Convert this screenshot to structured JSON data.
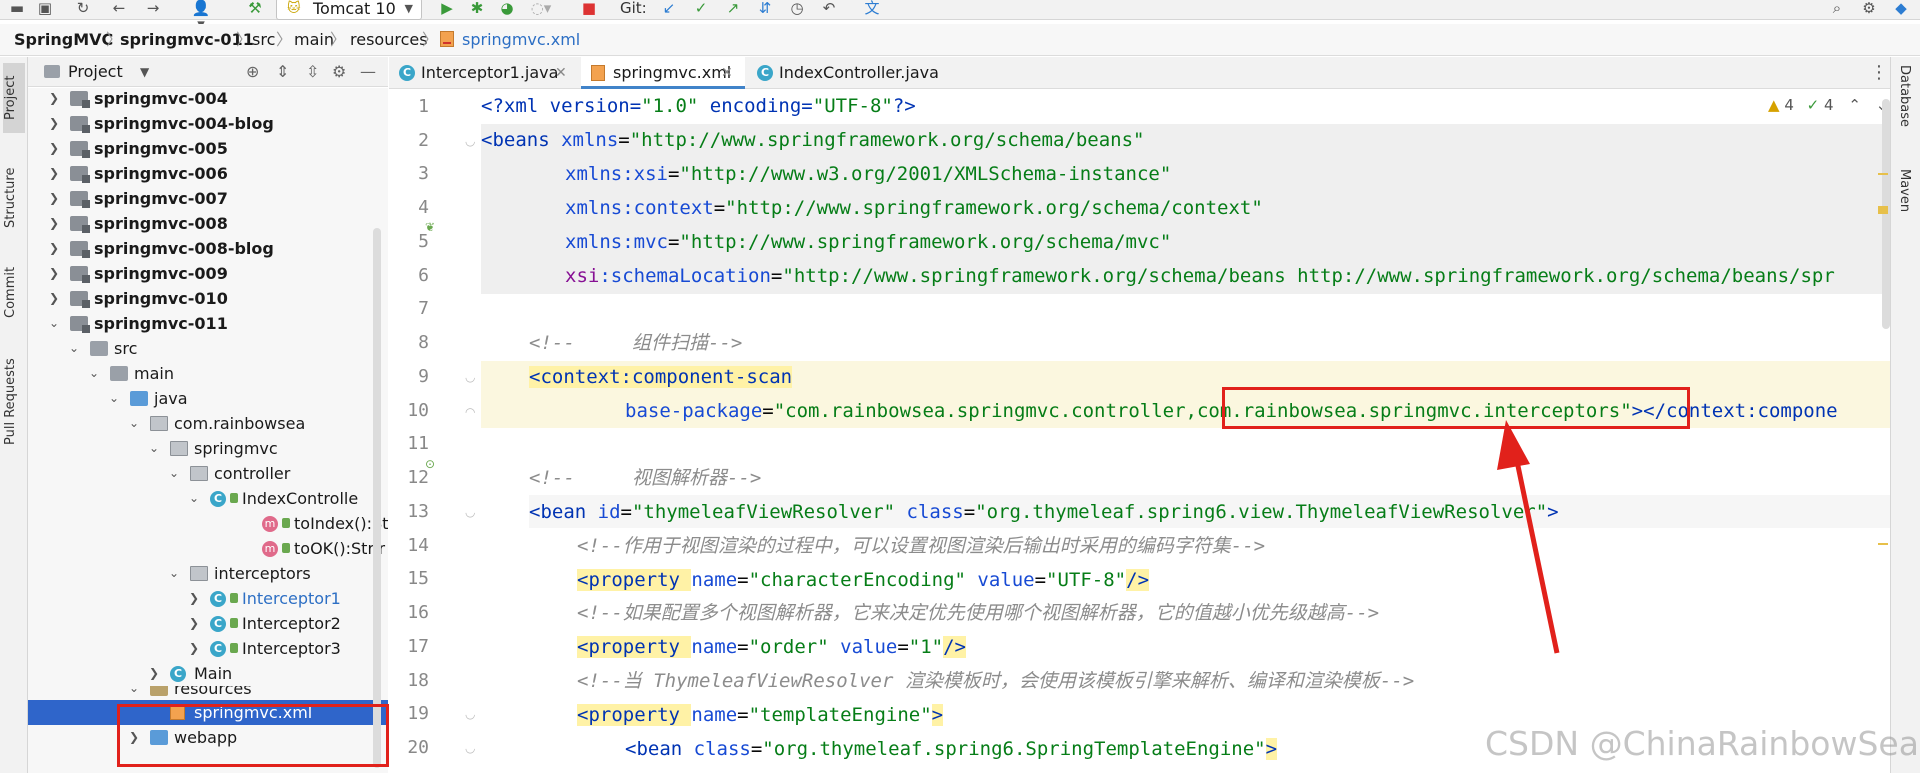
{
  "toolbar": {
    "run_config": "Tomcat 10",
    "git_label": "Git:"
  },
  "breadcrumb": [
    "SpringMVC",
    "springmvc-011",
    "src",
    "main",
    "resources",
    "springmvc.xml"
  ],
  "left_tabs": [
    "Project",
    "Structure",
    "Commit",
    "Pull Requests"
  ],
  "right_tabs": [
    "Database",
    "Maven"
  ],
  "project": {
    "title": "Project",
    "tree": [
      {
        "label": "springmvc-004",
        "bold": true
      },
      {
        "label": "springmvc-004-blog",
        "bold": true
      },
      {
        "label": "springmvc-005",
        "bold": true
      },
      {
        "label": "springmvc-006",
        "bold": true
      },
      {
        "label": "springmvc-007",
        "bold": true
      },
      {
        "label": "springmvc-008",
        "bold": true
      },
      {
        "label": "springmvc-008-blog",
        "bold": true
      },
      {
        "label": "springmvc-009",
        "bold": true
      },
      {
        "label": "springmvc-010",
        "bold": true
      },
      {
        "label": "springmvc-011",
        "bold": true
      },
      {
        "label": "src"
      },
      {
        "label": "main"
      },
      {
        "label": "java"
      },
      {
        "label": "com.rainbowsea"
      },
      {
        "label": "springmvc"
      },
      {
        "label": "controller"
      },
      {
        "label": "IndexControlle"
      },
      {
        "label": "toIndex():St"
      },
      {
        "label": "toOK():Strir"
      },
      {
        "label": "interceptors"
      },
      {
        "label": "Interceptor1"
      },
      {
        "label": "Interceptor2"
      },
      {
        "label": "Interceptor3"
      },
      {
        "label": "Main"
      },
      {
        "label": "resources"
      },
      {
        "label": "springmvc.xml"
      },
      {
        "label": "webapp"
      }
    ]
  },
  "tabs": [
    {
      "label": "Interceptor1.java"
    },
    {
      "label": "springmvc.xml"
    },
    {
      "label": "IndexController.java"
    }
  ],
  "inspections": {
    "warnings": "4",
    "weak": "4"
  },
  "code": {
    "l1": {
      "a": "<?xml version=",
      "b": "\"1.0\"",
      "c": " encoding=",
      "d": "\"UTF-8\"",
      "e": "?>"
    },
    "l2": {
      "a": "<beans ",
      "b": "xmlns",
      "c": "=",
      "d": "\"http://www.springframework.org/schema/beans\""
    },
    "l3": {
      "a": "xmlns",
      "b": ":xsi",
      "c": "=",
      "d": "\"http://www.w3.org/2001/XMLSchema-instance\""
    },
    "l4": {
      "a": "xmlns",
      "b": ":context",
      "c": "=",
      "d": "\"http://www.springframework.org/schema/context\""
    },
    "l5": {
      "a": "xmlns",
      "b": ":mvc",
      "c": "=",
      "d": "\"http://www.springframework.org/schema/mvc\""
    },
    "l6": {
      "a": "xsi",
      "b": ":schemaLocation",
      "c": "=",
      "d": "\"http://www.springframework.org/schema/beans http://www.springframework.org/schema/beans/spr"
    },
    "l8": "<!--     组件扫描-->",
    "l9": {
      "a": "<",
      "b": "context",
      "c": ":component-scan"
    },
    "l10": {
      "a": "base-package",
      "b": "=",
      "c": "\"com.rainbowsea.springmvc.controller,",
      "d": "com.rainbowsea.springmvc.interceptors\"",
      "e": ">",
      "f": "</",
      "g": "context",
      "h": ":compone"
    },
    "l12": "<!--     视图解析器-->",
    "l13": {
      "a": "<bean ",
      "b": "id",
      "c": "=",
      "d": "\"thymeleafViewResolver\"",
      "e": " class",
      "f": "=",
      "g": "\"org.thymeleaf.spring6.view.ThymeleafViewResolver\"",
      "h": ">"
    },
    "l14": "<!--作用于视图渲染的过程中，可以设置视图渲染后输出时采用的编码字符集-->",
    "l15": {
      "a": "<property ",
      "b": "name",
      "c": "=",
      "d": "\"characterEncoding\"",
      "e": " value",
      "f": "=",
      "g": "\"UTF-8\"",
      "h": "/>"
    },
    "l16": "<!--如果配置多个视图解析器，它来决定优先使用哪个视图解析器，它的值越小优先级越高-->",
    "l17": {
      "a": "<property ",
      "b": "name",
      "c": "=",
      "d": "\"order\"",
      "e": " value",
      "f": "=",
      "g": "\"1\"",
      "h": "/>"
    },
    "l18": "<!--当 ThymeleafViewResolver 渲染模板时，会使用该模板引擎来解析、编译和渲染模板-->",
    "l19": {
      "a": "<property ",
      "b": "name",
      "c": "=",
      "d": "\"templateEngine\"",
      "e": ">"
    },
    "l20": {
      "a": "<bean ",
      "b": "class",
      "c": "=",
      "d": "\"org.thymeleaf.spring6.SpringTemplateEngine\"",
      "e": ">"
    }
  },
  "line_numbers": [
    "1",
    "2",
    "3",
    "4",
    "5",
    "6",
    "7",
    "8",
    "9",
    "10",
    "11",
    "12",
    "13",
    "14",
    "15",
    "16",
    "17",
    "18",
    "19",
    "20"
  ],
  "watermark": "CSDN @ChinaRainbowSea",
  "colors": {
    "annotation": "#e1211b",
    "selection": "#2f65ca"
  }
}
